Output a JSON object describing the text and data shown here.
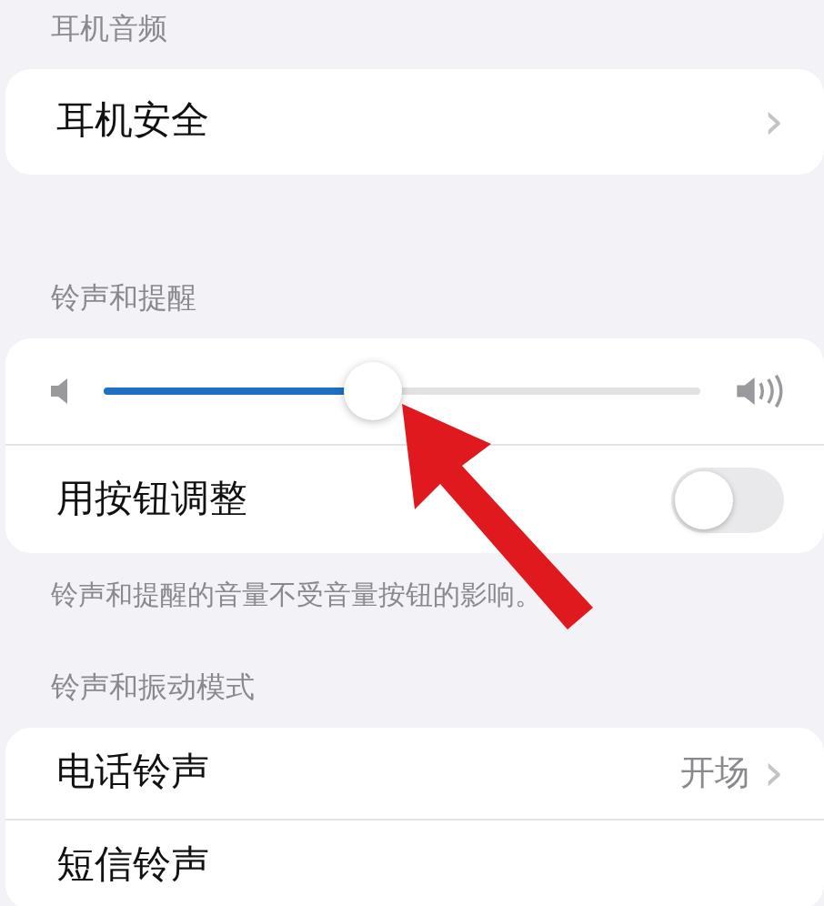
{
  "sections": [
    {
      "header": "耳机音频",
      "rows": [
        {
          "kind": "link",
          "label": "耳机安全",
          "chevron": "›"
        }
      ]
    },
    {
      "header": "铃声和提醒",
      "rows": [
        {
          "kind": "slider",
          "level": 0.45
        },
        {
          "kind": "toggle",
          "label": "用按钮调整",
          "on": false
        }
      ],
      "footer": "铃声和提醒的音量不受音量按钮的影响。"
    },
    {
      "header": "铃声和振动模式",
      "rows": [
        {
          "kind": "link",
          "label": "电话铃声",
          "value": "开场",
          "chevron": "›"
        },
        {
          "kind": "link",
          "label": "短信铃声"
        }
      ]
    }
  ],
  "annotation": {
    "kind": "arrow"
  }
}
